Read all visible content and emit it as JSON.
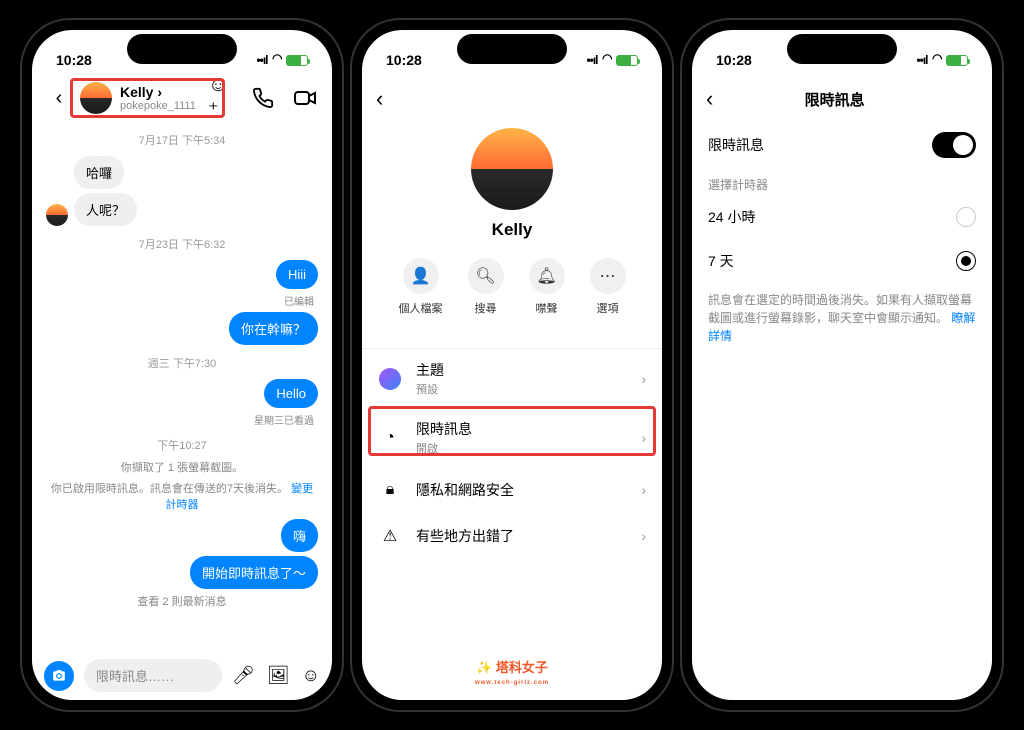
{
  "status": {
    "time": "10:28",
    "icon_hint": "🕭"
  },
  "phone1": {
    "user": {
      "name": "Kelly",
      "handle": "pokepoke_1111"
    },
    "ts1": "7月17日 下午5:34",
    "m1": "哈囉",
    "m2": "人呢？",
    "ts2": "7月23日 下午6:32",
    "m3": "Hiii",
    "edited": "已編輯",
    "m4": "你在幹嘛？",
    "ts3": "週三 下午7:30",
    "m5": "Hello",
    "seen": "星期三已看過",
    "ts4": "下午10:27",
    "sys1": "你擷取了 1 張螢幕截圖。",
    "sys2a": "你已啟用限時訊息。訊息會在傳送的7天後消失。",
    "sys2b": "變更計時器",
    "m6": "嗨",
    "m7": "開始即時訊息了～",
    "sys3": "查看 2 則最新消息",
    "input_placeholder": "限時訊息……"
  },
  "phone2": {
    "name": "Kelly",
    "actions": {
      "profile": "個人檔案",
      "search": "搜尋",
      "mute": "噤聲",
      "options": "選項"
    },
    "items": {
      "theme": {
        "title": "主題",
        "sub": "預設"
      },
      "disappearing": {
        "title": "限時訊息",
        "sub": "開啟"
      },
      "privacy": "隱私和網路安全",
      "error": "有些地方出錯了"
    },
    "watermark": "塔科女子",
    "watermark_sub": "www.tech-girlz.com"
  },
  "phone3": {
    "title": "限時訊息",
    "toggle_label": "限時訊息",
    "section": "選擇計時器",
    "opt1": "24 小時",
    "opt2": "7 天",
    "helper": "訊息會在選定的時間過後消失。如果有人擷取螢幕截圖或進行螢幕錄影，聊天室中會顯示通知。",
    "helper_link": "瞭解詳情"
  }
}
